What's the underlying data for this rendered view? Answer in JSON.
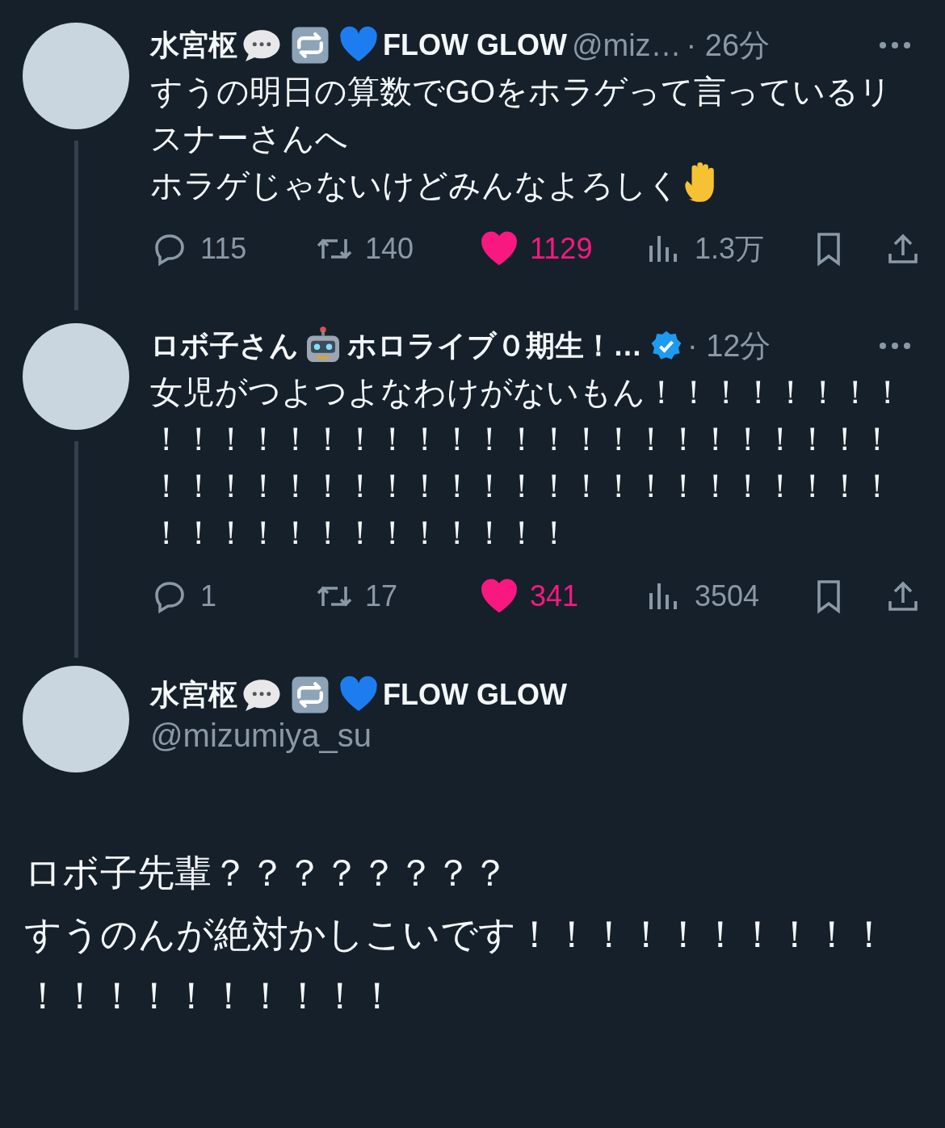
{
  "tweets": [
    {
      "name": [
        {
          "kind": "text",
          "text": "水宮枢"
        },
        {
          "kind": "speech"
        },
        {
          "kind": "repeat"
        },
        {
          "kind": "heart"
        },
        {
          "kind": "text",
          "text": "FLOW GLOW"
        }
      ],
      "verified": false,
      "handle": "@miz…",
      "time": "· 26分",
      "body": [
        {
          "kind": "text",
          "text": "すうの明日の算数でGOをホラゲって言っているリスナーさんへ"
        },
        {
          "kind": "text",
          "text": "ホラゲじゃないけどみんなよろしく"
        },
        {
          "kind": "hand"
        }
      ],
      "stats": [
        {
          "kind": "reply",
          "count": "115"
        },
        {
          "kind": "retweet",
          "count": "140"
        },
        {
          "kind": "like",
          "count": "1129",
          "liked": true
        },
        {
          "kind": "views",
          "count": "1.3万"
        }
      ]
    },
    {
      "name": [
        {
          "kind": "text",
          "text": "ロボ子さん"
        },
        {
          "kind": "robot"
        },
        {
          "kind": "text",
          "text": "ホロライブ０期生！…"
        }
      ],
      "verified": true,
      "time": "· 12分",
      "body": [
        {
          "kind": "text",
          "text": "女児がつよつよなわけがないもん！！！！！！！！！！！！！！！！！！！！！！！！！！！！！！！！！！！！！！！！！！！！！！！！！！！！！！！！！！！！！！！！！！！"
        }
      ],
      "stats": [
        {
          "kind": "reply",
          "count": "1"
        },
        {
          "kind": "retweet",
          "count": "17"
        },
        {
          "kind": "like",
          "count": "341",
          "liked": true
        },
        {
          "kind": "views",
          "count": "3504"
        }
      ]
    }
  ],
  "main": {
    "name": [
      {
        "kind": "text",
        "text": "水宮枢"
      },
      {
        "kind": "speech"
      },
      {
        "kind": "repeat"
      },
      {
        "kind": "heart"
      },
      {
        "kind": "text",
        "text": "FLOW GLOW"
      }
    ],
    "handle": "@mizumiya_su",
    "lines": [
      "ロボ子先輩？？？？？？？？",
      "すうのんが絶対かしこいです！！！！！！！！！！！！！！！！！！！！"
    ]
  }
}
